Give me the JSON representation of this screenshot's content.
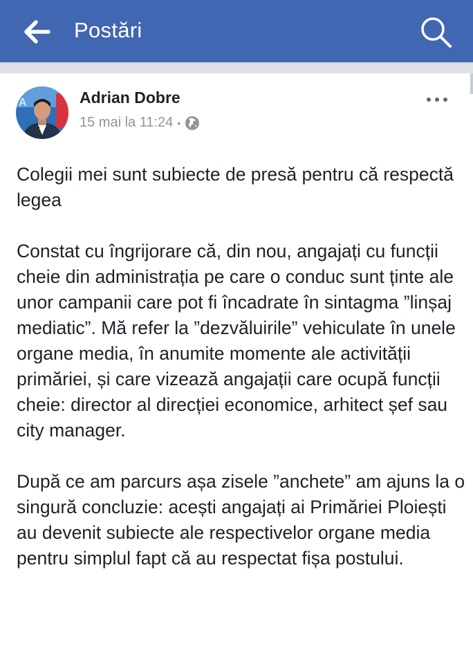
{
  "header": {
    "title": "Postări",
    "back_icon": "arrow-left-icon",
    "search_icon": "search-icon",
    "background_color": "#4267b2"
  },
  "post": {
    "author": "Adrian Dobre",
    "date": "15 mai la 11:24",
    "separator": "•",
    "privacy_icon": "globe-icon",
    "more_icon": "more-horizontal-icon",
    "paragraphs": [
      "Colegii mei sunt subiecte de presă pentru că respectă legea",
      "Constat cu îngrijorare că, din nou, angajați cu funcții cheie din administrația pe care o conduc sunt ținte ale unor campanii care pot fi încadrate în sintagma ”linșaj mediatic”. Mă refer la ”dezvăluirile” vehiculate în unele organe media, în anumite momente ale activității primăriei, și care vizează angajații care ocupă funcții cheie: director al direcției economice, arhitect șef sau city manager.",
      "După ce am parcurs așa zisele ”anchete” am ajuns la o singură concluzie: acești angajați ai Primăriei Ploiești au devenit subiecte ale respectivelor organe media pentru simplul fapt că au respectat fișa postului."
    ]
  }
}
